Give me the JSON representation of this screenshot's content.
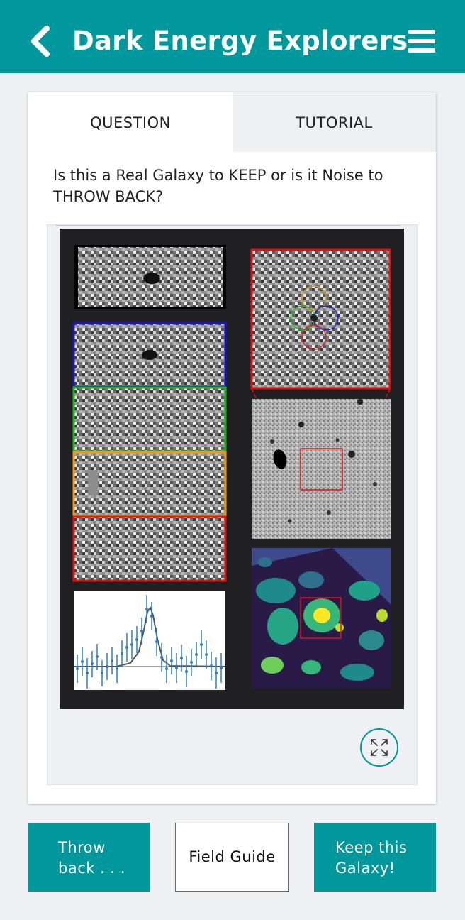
{
  "header": {
    "title": "Dark Energy Explorers",
    "back_icon": "chevron-left-icon",
    "menu_icon": "hamburger-menu-icon",
    "background": "#00979d"
  },
  "tabs": [
    {
      "label": "QUESTION",
      "active": true
    },
    {
      "label": "TUTORIAL",
      "active": false
    }
  ],
  "question": {
    "text": "Is this a Real Galaxy to KEEP or is it Noise to THROW BACK?"
  },
  "subject": {
    "panel_outline_colors": [
      "#1616c8",
      "#1fb31f",
      "#f39b0e",
      "#e01212"
    ],
    "aperture_circle_colors": [
      "#d19a2a",
      "#1fb31f",
      "#2222cc",
      "#d02222"
    ],
    "expand_icon": "expand-arrows-icon"
  },
  "actions": {
    "throw_back_line1": "Throw",
    "throw_back_line2": "back . . .",
    "field_guide": "Field Guide",
    "keep_line1": "Keep this",
    "keep_line2": "Galaxy!"
  },
  "colors": {
    "accent": "#00979d",
    "page_background": "#eef0f4"
  }
}
